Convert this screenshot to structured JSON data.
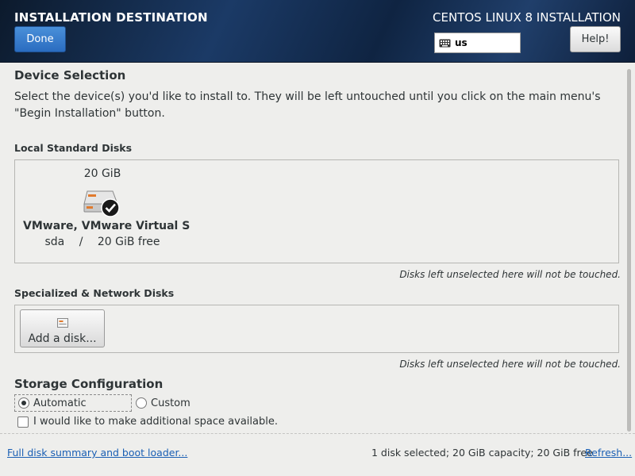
{
  "header": {
    "title": "INSTALLATION DESTINATION",
    "product": "CENTOS LINUX 8 INSTALLATION",
    "done_label": "Done",
    "help_label": "Help!",
    "keyboard_layout": "us"
  },
  "device_selection": {
    "title": "Device Selection",
    "description": "Select the device(s) you'd like to install to.  They will be left untouched until you click on the main menu's \"Begin Installation\" button."
  },
  "local_disks": {
    "label": "Local Standard Disks",
    "note": "Disks left unselected here will not be touched.",
    "disks": [
      {
        "size": "20 GiB",
        "name": "VMware, VMware Virtual S",
        "device": "sda",
        "separator": "/",
        "free": "20 GiB free",
        "selected": true
      }
    ]
  },
  "network_disks": {
    "label": "Specialized & Network Disks",
    "add_label": "Add a disk...",
    "note": "Disks left unselected here will not be touched."
  },
  "storage": {
    "title": "Storage Configuration",
    "automatic_label": "Automatic",
    "custom_label": "Custom",
    "selected": "automatic",
    "extra_space_label": "I would like to make additional space available.",
    "extra_space_checked": false
  },
  "footer": {
    "summary_link": "Full disk summary and boot loader...",
    "status": "1 disk selected; 20 GiB capacity; 20 GiB free",
    "refresh_link": "Refresh..."
  },
  "colors": {
    "accent": "#2a6cc0",
    "link": "#1a5fb4",
    "background": "#eeeeec"
  }
}
